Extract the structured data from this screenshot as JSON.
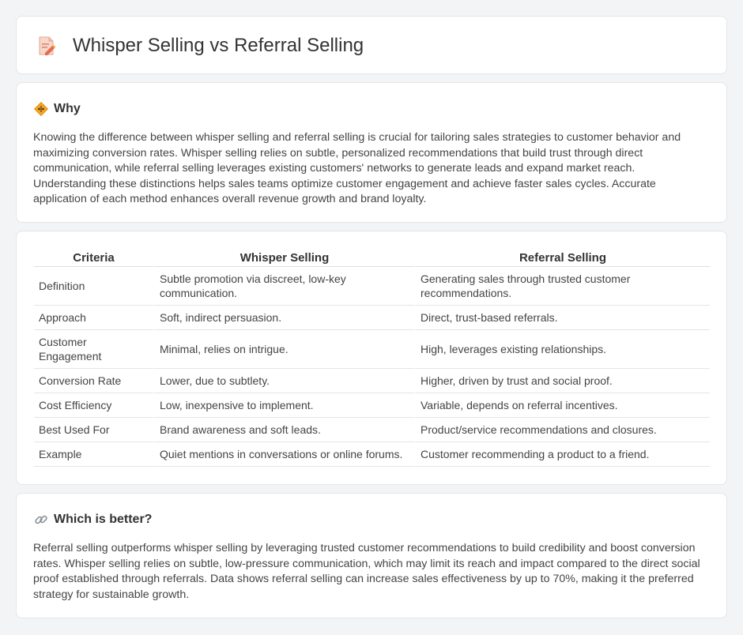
{
  "header": {
    "title": "Whisper Selling vs Referral Selling",
    "icon": "document-pencil-icon"
  },
  "why": {
    "heading": "Why",
    "icon": "diamond-sign-icon",
    "text": "Knowing the difference between whisper selling and referral selling is crucial for tailoring sales strategies to customer behavior and maximizing conversion rates. Whisper selling relies on subtle, personalized recommendations that build trust through direct communication, while referral selling leverages existing customers' networks to generate leads and expand market reach. Understanding these distinctions helps sales teams optimize customer engagement and achieve faster sales cycles. Accurate application of each method enhances overall revenue growth and brand loyalty."
  },
  "table": {
    "headers": [
      "Criteria",
      "Whisper Selling",
      "Referral Selling"
    ],
    "rows": [
      [
        "Definition",
        "Subtle promotion via discreet, low-key communication.",
        "Generating sales through trusted customer recommendations."
      ],
      [
        "Approach",
        "Soft, indirect persuasion.",
        "Direct, trust-based referrals."
      ],
      [
        "Customer Engagement",
        "Minimal, relies on intrigue.",
        "High, leverages existing relationships."
      ],
      [
        "Conversion Rate",
        "Lower, due to subtlety.",
        "Higher, driven by trust and social proof."
      ],
      [
        "Cost Efficiency",
        "Low, inexpensive to implement.",
        "Variable, depends on referral incentives."
      ],
      [
        "Best Used For",
        "Brand awareness and soft leads.",
        "Product/service recommendations and closures."
      ],
      [
        "Example",
        "Quiet mentions in conversations or online forums.",
        "Customer recommending a product to a friend."
      ]
    ]
  },
  "better": {
    "heading": "Which is better?",
    "icon": "link-icon",
    "text": "Referral selling outperforms whisper selling by leveraging trusted customer recommendations to build credibility and boost conversion rates. Whisper selling relies on subtle, low-pressure communication, which may limit its reach and impact compared to the direct social proof established through referrals. Data shows referral selling can increase sales effectiveness by up to 70%, making it the preferred strategy for sustainable growth."
  }
}
